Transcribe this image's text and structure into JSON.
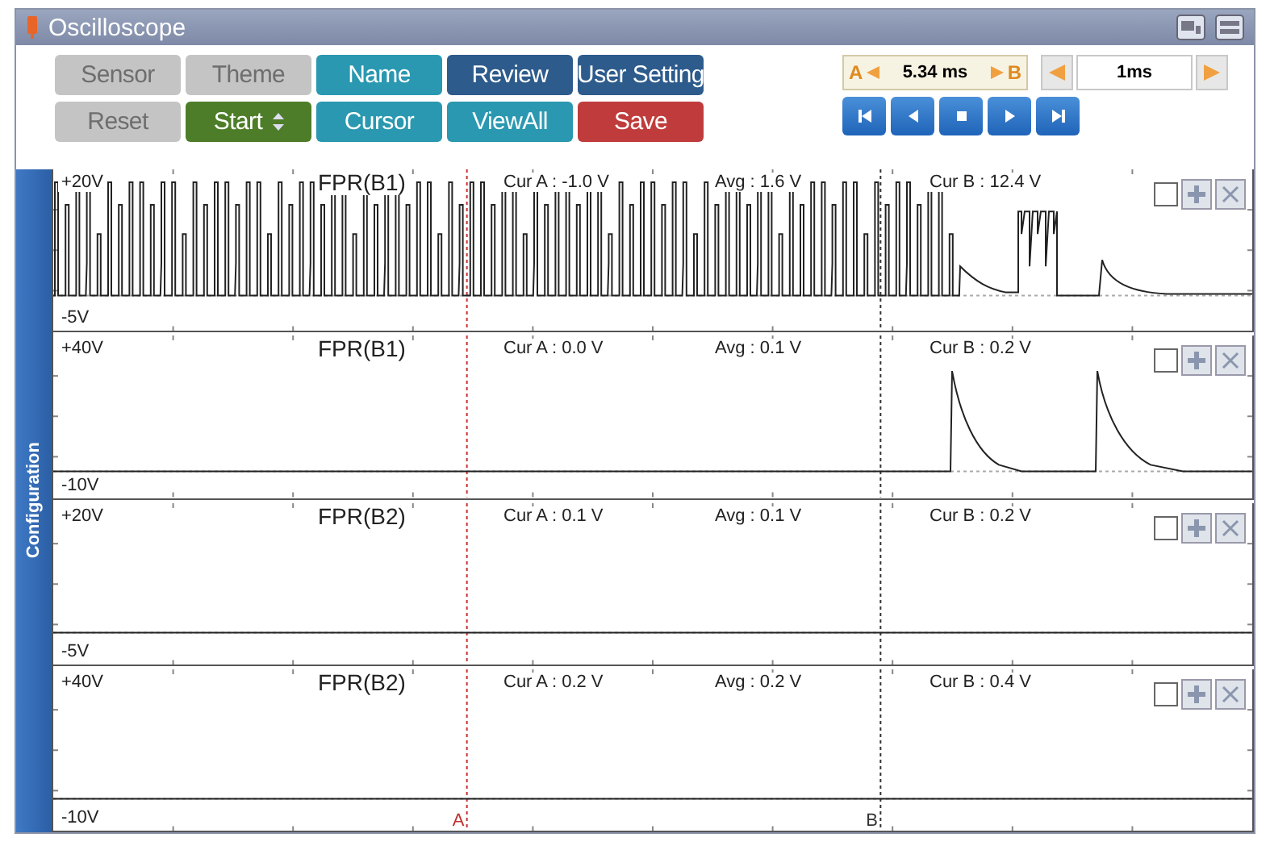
{
  "window": {
    "title": "Oscilloscope"
  },
  "toolbar": {
    "rows": [
      [
        {
          "label": "Sensor",
          "disabled": true,
          "color": "#c4c4c4"
        },
        {
          "label": "Theme",
          "disabled": true,
          "color": "#c4c4c4"
        },
        {
          "label": "Name",
          "disabled": false,
          "color": "#2a98b0"
        },
        {
          "label": "Review",
          "disabled": false,
          "color": "#2d5b8c"
        },
        {
          "label": "User Setting",
          "disabled": false,
          "color": "#2d5b8c"
        }
      ],
      [
        {
          "label": "Reset",
          "disabled": true,
          "color": "#c4c4c4"
        },
        {
          "label": "Start",
          "disabled": false,
          "color": "#4d7d28",
          "spinner": true
        },
        {
          "label": "Cursor",
          "disabled": false,
          "color": "#2a98b0"
        },
        {
          "label": "ViewAll",
          "disabled": false,
          "color": "#2a98b0"
        },
        {
          "label": "Save",
          "disabled": false,
          "color": "#c03c3c"
        }
      ]
    ]
  },
  "cursor_readout": {
    "a_label": "A",
    "value": "5.34 ms",
    "b_label": "B"
  },
  "time_step": {
    "value": "1ms"
  },
  "side_tab": {
    "label": "Configuration"
  },
  "cursors": {
    "a_label": "A",
    "b_label": "B"
  },
  "channels": [
    {
      "name": "FPR(B1)",
      "scale_top": "+20V",
      "scale_bottom": "-5V",
      "cur_a": "Cur A : -1.0 V",
      "avg": "Avg : 1.6 V",
      "cur_b": "Cur B : 12.4 V",
      "checked": false,
      "kind": "pulse-train"
    },
    {
      "name": "FPR(B1)",
      "scale_top": "+40V",
      "scale_bottom": "-10V",
      "cur_a": "Cur A : 0.0 V",
      "avg": "Avg : 0.1 V",
      "cur_b": "Cur B : 0.2 V",
      "checked": false,
      "kind": "spikes"
    },
    {
      "name": "FPR(B2)",
      "scale_top": "+20V",
      "scale_bottom": "-5V",
      "cur_a": "Cur A : 0.1 V",
      "avg": "Avg : 0.1 V",
      "cur_b": "Cur B : 0.2 V",
      "checked": false,
      "kind": "flat"
    },
    {
      "name": "FPR(B2)",
      "scale_top": "+40V",
      "scale_bottom": "-10V",
      "cur_a": "Cur A : 0.2 V",
      "avg": "Avg : 0.2 V",
      "cur_b": "Cur B : 0.4 V",
      "checked": false,
      "kind": "flat"
    }
  ]
}
